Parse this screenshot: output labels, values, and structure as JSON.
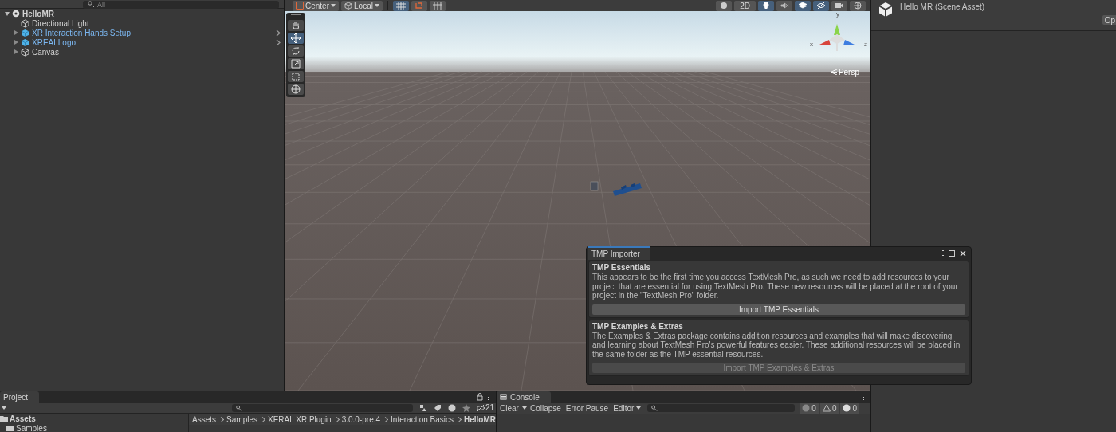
{
  "hierarchy": {
    "search": {
      "placeholder": "All"
    },
    "tree": [
      {
        "label": "HelloMR",
        "kind": "scene",
        "expanded": true,
        "children": [
          {
            "label": "Directional Light",
            "kind": "object"
          },
          {
            "label": "XR Interaction Hands Setup",
            "kind": "prefab",
            "expanded": false
          },
          {
            "label": "XREALLogo",
            "kind": "prefab",
            "expanded": false
          },
          {
            "label": "Canvas",
            "kind": "object",
            "expanded": false
          }
        ]
      }
    ]
  },
  "scene_toolbar": {
    "pivot": "Center",
    "space": "Local",
    "mode_2d": "2D",
    "left_toggles": [
      {
        "kind": "grid",
        "selected": true
      },
      {
        "kind": "snap",
        "selected": false
      },
      {
        "kind": "increment",
        "selected": false
      }
    ],
    "right_toggles": [
      {
        "kind": "shading",
        "selected": false
      },
      {
        "kind": "lighting",
        "selected": true
      },
      {
        "kind": "audio",
        "selected": false
      },
      {
        "kind": "effects",
        "selected": true
      },
      {
        "kind": "hidden",
        "selected": true
      },
      {
        "kind": "camera",
        "selected": false
      },
      {
        "kind": "gizmos",
        "selected": false
      }
    ]
  },
  "tools": [
    {
      "kind": "hand",
      "selected": false
    },
    {
      "kind": "move",
      "selected": true
    },
    {
      "kind": "rotate",
      "selected": false
    },
    {
      "kind": "scale",
      "selected": false
    },
    {
      "kind": "rect",
      "selected": false
    },
    {
      "kind": "transform",
      "selected": false
    }
  ],
  "gizmo": {
    "axes": [
      "y",
      "x",
      "z"
    ],
    "projection": "Persp"
  },
  "inspector": {
    "title": "Hello MR (Scene Asset)",
    "button": "Op"
  },
  "tmp_importer": {
    "tab": "TMP Importer",
    "sections": [
      {
        "title": "TMP Essentials",
        "text": "This appears to be the first time you access TextMesh Pro, as such we need to add resources to your project that are essential for using TextMesh Pro. These new resources will be placed at the root of your project in the \"TextMesh Pro\" folder.",
        "button": "Import TMP Essentials",
        "disabled": false
      },
      {
        "title": "TMP Examples & Extras",
        "text": "The Examples & Extras package contains addition resources and examples that will make discovering and learning about TextMesh Pro's powerful features easier. These additional resources will be placed in the same folder as the TMP essential resources.",
        "button": "Import TMP Examples & Extras",
        "disabled": true
      }
    ]
  },
  "project": {
    "tab": "Project",
    "hidden_count": "21",
    "tree": [
      {
        "label": "Assets",
        "children": [
          {
            "label": "Samples"
          }
        ]
      }
    ],
    "breadcrumbs": [
      "Assets",
      "Samples",
      "XERAL XR Plugin",
      "3.0.0-pre.4",
      "Interaction Basics",
      "HelloMR"
    ]
  },
  "console": {
    "tab": "Console",
    "buttons": [
      "Clear",
      "Collapse",
      "Error Pause",
      "Editor"
    ],
    "counts": [
      {
        "kind": "info",
        "count": "0"
      },
      {
        "kind": "warning",
        "count": "0"
      },
      {
        "kind": "error",
        "count": "0"
      }
    ]
  }
}
